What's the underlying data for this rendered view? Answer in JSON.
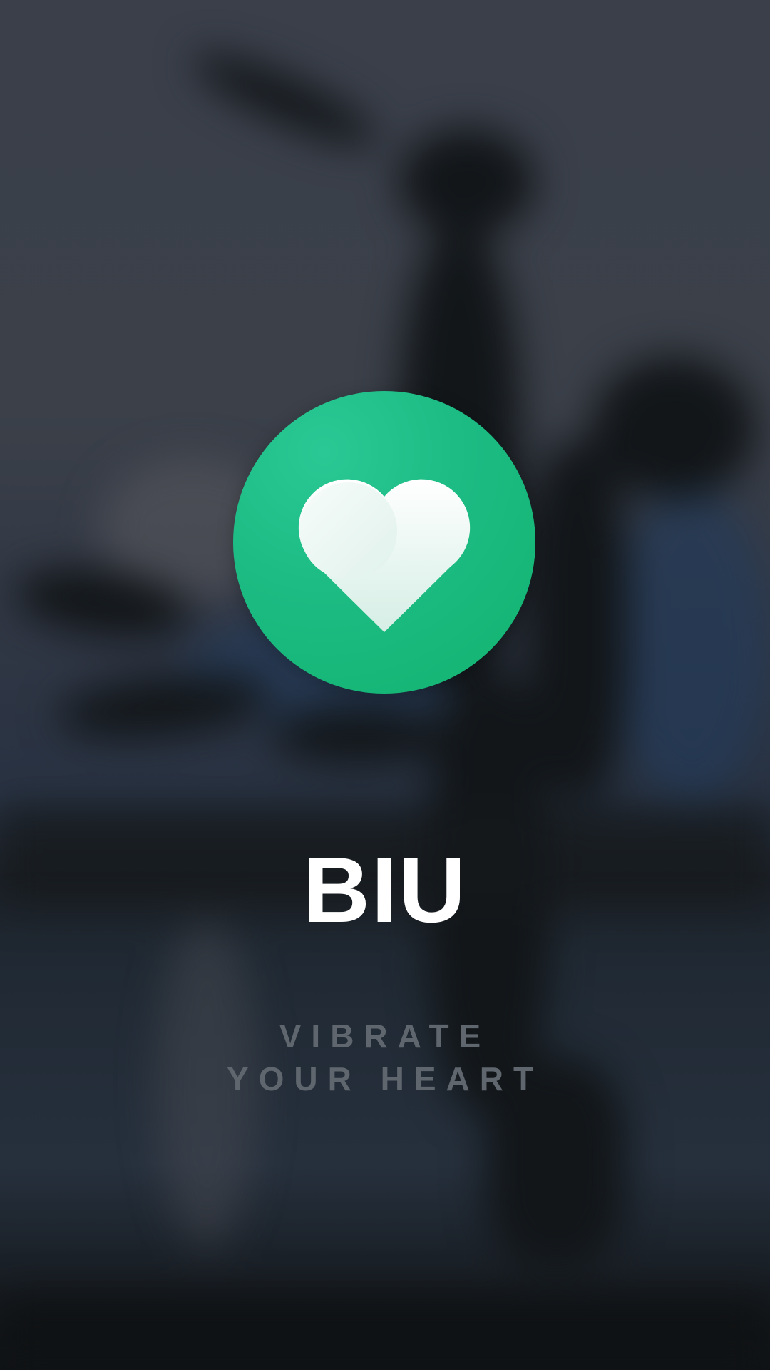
{
  "splash": {
    "app_name": "BIU",
    "tagline": "VIBRATE YOUR HEART",
    "logo_icon": "heart-icon",
    "colors": {
      "logo_circle": "#1cbb83",
      "title": "#ffffff",
      "tagline": "#5f666d"
    }
  }
}
